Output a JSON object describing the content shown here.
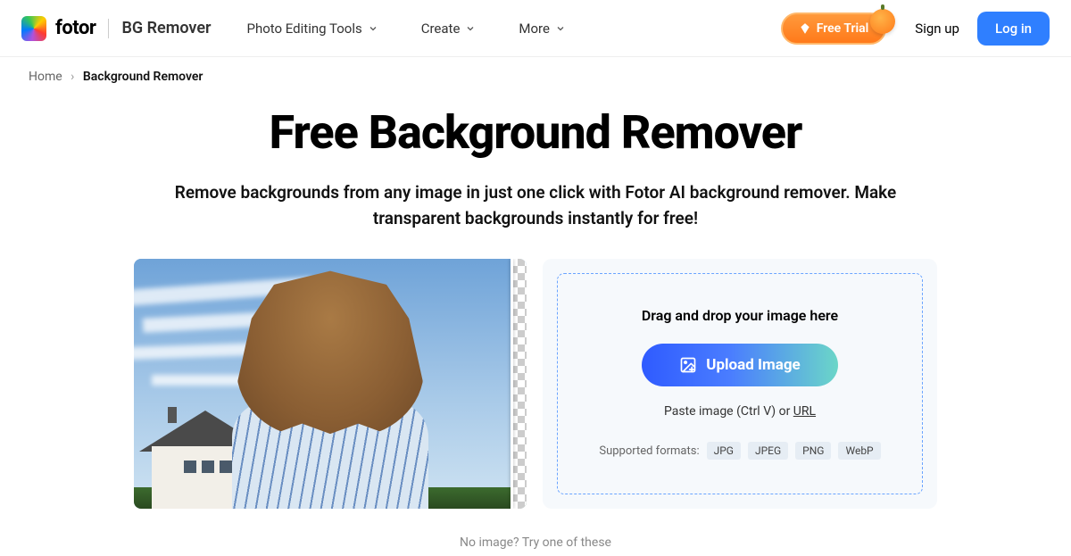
{
  "brand": {
    "name": "fotor",
    "sub": "BG Remover"
  },
  "nav": {
    "items": [
      "Photo Editing Tools",
      "Create",
      "More"
    ]
  },
  "header": {
    "free_trial": "Free Trial",
    "signup": "Sign up",
    "login": "Log in"
  },
  "breadcrumb": {
    "home": "Home",
    "current": "Background Remover"
  },
  "hero": {
    "title": "Free Background Remover",
    "subtitle": "Remove backgrounds from any image in just one click with Fotor AI background remover. Make transparent backgrounds instantly for free!"
  },
  "upload": {
    "drop_text": "Drag and drop your image here",
    "button": "Upload Image",
    "paste_prefix": "Paste image (Ctrl V) or ",
    "paste_url": "URL",
    "formats_label": "Supported formats:",
    "formats": [
      "JPG",
      "JPEG",
      "PNG",
      "WebP"
    ]
  },
  "footer": {
    "no_image": "No image? Try one of these"
  }
}
